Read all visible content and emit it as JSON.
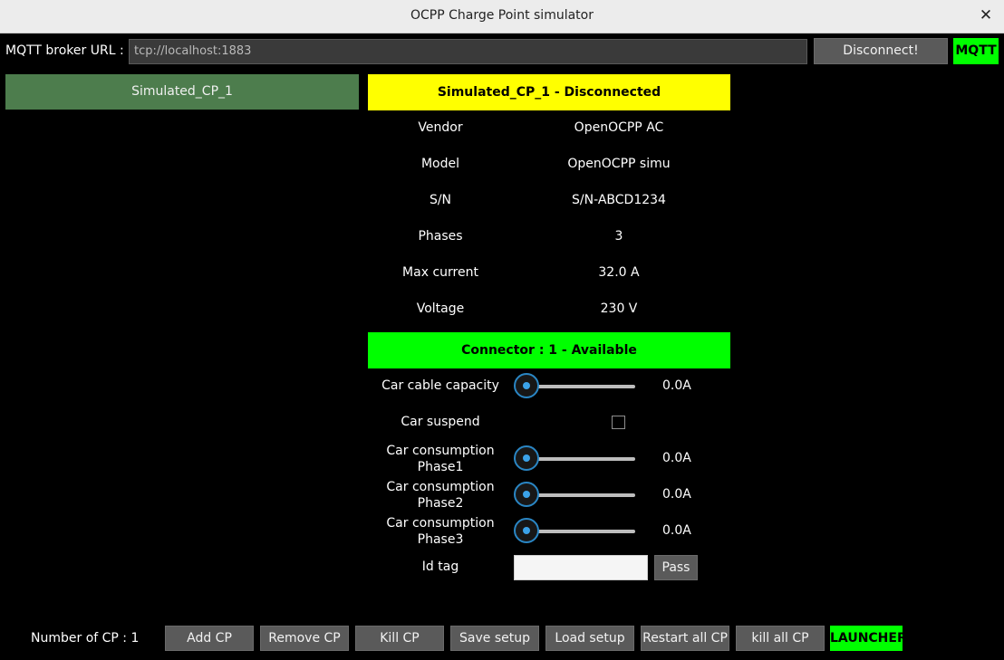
{
  "window": {
    "title": "OCPP Charge Point simulator"
  },
  "mqtt": {
    "broker_label": "MQTT broker URL :",
    "broker_url": "tcp://localhost:1883",
    "disconnect_label": "Disconnect!",
    "status_label": "MQTT",
    "status_color": "#00ff00"
  },
  "cp_list": [
    {
      "label": "Simulated_CP_1"
    }
  ],
  "cp": {
    "header": "Simulated_CP_1 - Disconnected",
    "header_color": "#ffff00",
    "info": [
      {
        "label": "Vendor",
        "value": "OpenOCPP AC"
      },
      {
        "label": "Model",
        "value": "OpenOCPP simu"
      },
      {
        "label": "S/N",
        "value": "S/N-ABCD1234"
      },
      {
        "label": "Phases",
        "value": "3"
      },
      {
        "label": "Max current",
        "value": "32.0 A"
      },
      {
        "label": "Voltage",
        "value": "230 V"
      }
    ]
  },
  "connector": {
    "header": "Connector : 1 - Available",
    "header_color": "#00ff00",
    "cable_capacity": {
      "label": "Car cable capacity",
      "value": "0.0A",
      "level": 0
    },
    "suspend": {
      "label": "Car suspend",
      "checked": false
    },
    "phase1": {
      "label_line1": "Car consumption",
      "label_line2": "Phase1",
      "value": "0.0A",
      "level": 0
    },
    "phase2": {
      "label_line1": "Car consumption",
      "label_line2": "Phase2",
      "value": "0.0A",
      "level": 0
    },
    "phase3": {
      "label_line1": "Car consumption",
      "label_line2": "Phase3",
      "value": "0.0A",
      "level": 0
    },
    "id_tag": {
      "label": "Id tag",
      "value": "",
      "pass_label": "Pass"
    }
  },
  "footer": {
    "count_label": "Number of CP : 1",
    "buttons": {
      "add": "Add CP",
      "remove": "Remove CP",
      "kill": "Kill CP",
      "save": "Save setup",
      "load": "Load setup",
      "restart_all": "Restart all CP",
      "kill_all": "kill all CP"
    },
    "launcher_label": "LAUNCHER",
    "launcher_color": "#00ff00"
  },
  "icons": {
    "close": "close-icon",
    "slider_knob": "slider-knob-icon"
  }
}
